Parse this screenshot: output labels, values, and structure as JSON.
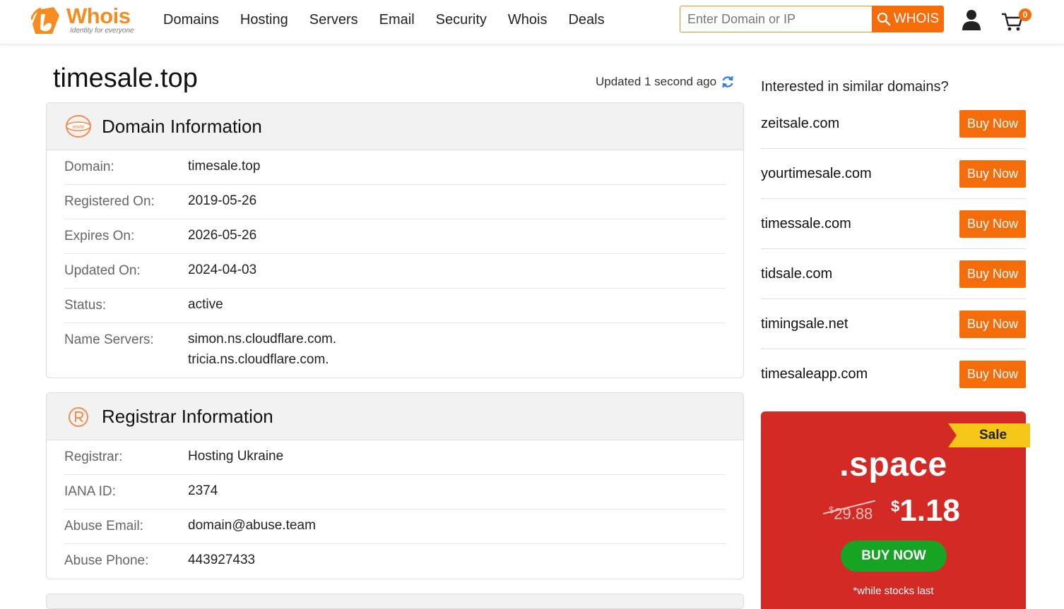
{
  "header": {
    "logo_text": "Whois",
    "logo_tagline": "Identity for everyone",
    "nav": [
      "Domains",
      "Hosting",
      "Servers",
      "Email",
      "Security",
      "Whois",
      "Deals"
    ],
    "search_placeholder": "Enter Domain or IP",
    "search_button": "WHOIS",
    "cart_count": "0"
  },
  "page": {
    "title": "timesale.top",
    "updated": "Updated 1 second ago"
  },
  "domain_info": {
    "title": "Domain Information",
    "icon_text": "www",
    "rows": [
      {
        "label": "Domain:",
        "value": "timesale.top"
      },
      {
        "label": "Registered On:",
        "value": "2019-05-26"
      },
      {
        "label": "Expires On:",
        "value": "2026-05-26"
      },
      {
        "label": "Updated On:",
        "value": "2024-04-03"
      },
      {
        "label": "Status:",
        "value": "active"
      },
      {
        "label": "Name Servers:",
        "value": "simon.ns.cloudflare.com.",
        "value2": "tricia.ns.cloudflare.com."
      }
    ]
  },
  "registrar_info": {
    "title": "Registrar Information",
    "rows": [
      {
        "label": "Registrar:",
        "value": "Hosting Ukraine"
      },
      {
        "label": "IANA ID:",
        "value": "2374"
      },
      {
        "label": "Abuse Email:",
        "value": "domain@abuse.team"
      },
      {
        "label": "Abuse Phone:",
        "value": "443927433"
      }
    ]
  },
  "similar": {
    "title": "Interested in similar domains?",
    "button_label": "Buy Now",
    "domains": [
      "zeitsale.com",
      "yourtimesale.com",
      "timessale.com",
      "tidsale.com",
      "timingsale.net",
      "timesaleapp.com"
    ]
  },
  "promo": {
    "ribbon": "Sale",
    "tld": ".space",
    "old_currency": "$",
    "old_price": "29.88",
    "new_currency": "$",
    "new_price": "1.18",
    "button": "BUY NOW",
    "note": "*while stocks last"
  },
  "colors": {
    "brand_orange": "#f56c0a",
    "promo_red": "#d42a25",
    "promo_green": "#17a323",
    "ribbon_yellow": "#f5c518"
  }
}
